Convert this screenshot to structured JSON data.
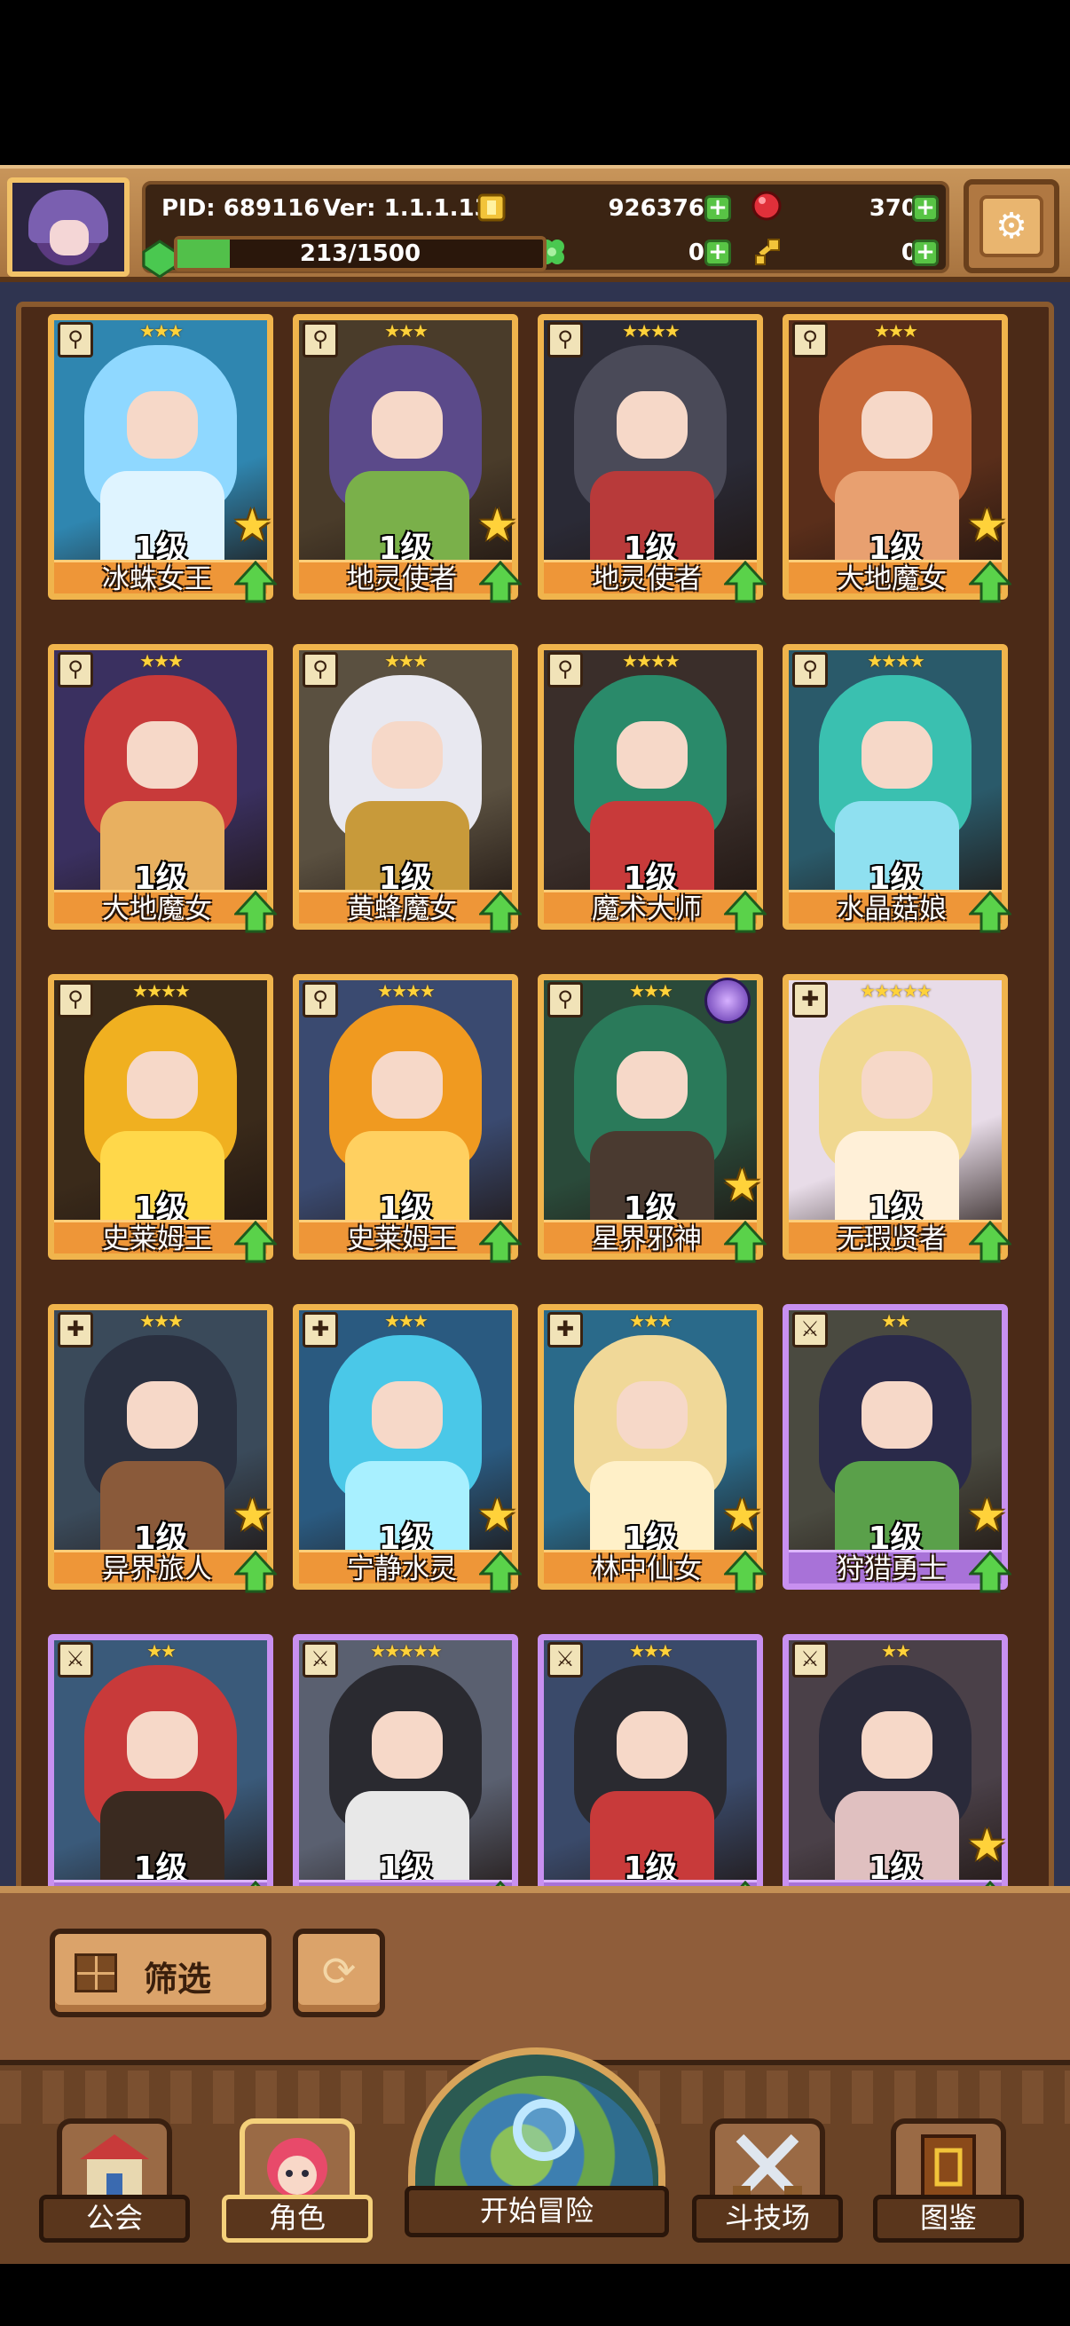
{
  "header": {
    "pid_label": "PID: 689116",
    "version_label": "Ver: 1.1.1.13",
    "gold": "926376",
    "gems": "370",
    "xp_text": "213/1500",
    "xp_progress": 0.142,
    "clover": "0",
    "key": "0"
  },
  "cards": [
    {
      "name": "冰蛛女王",
      "level": "1级",
      "stars": "★★★",
      "frame": "gold",
      "class_icon": "wand-icon",
      "star_badge": true,
      "palette": [
        "#2f86b0",
        "#8fd8ff",
        "#dff4ff"
      ]
    },
    {
      "name": "地灵使者",
      "level": "1级",
      "stars": "★★★",
      "frame": "gold",
      "class_icon": "wand-icon",
      "star_badge": true,
      "palette": [
        "#4a3c2a",
        "#5b4a8a",
        "#7ab04a"
      ]
    },
    {
      "name": "地灵使者",
      "level": "1级",
      "stars": "★★★★",
      "frame": "gold",
      "class_icon": "wand-icon",
      "star_badge": false,
      "palette": [
        "#2a2a36",
        "#4a4a58",
        "#b83a3a"
      ]
    },
    {
      "name": "大地魔女",
      "level": "1级",
      "stars": "★★★",
      "frame": "gold",
      "class_icon": "wand-icon",
      "star_badge": true,
      "palette": [
        "#5a2e1a",
        "#c86a3a",
        "#e8a070"
      ]
    },
    {
      "name": "大地魔女",
      "level": "1级",
      "stars": "★★★",
      "frame": "gold",
      "class_icon": "wand-icon",
      "star_badge": false,
      "palette": [
        "#3a3060",
        "#c83a3a",
        "#e8b060"
      ]
    },
    {
      "name": "黄蜂魔女",
      "level": "1级",
      "stars": "★★★",
      "frame": "gold",
      "class_icon": "wand-icon",
      "star_badge": false,
      "palette": [
        "#5a5040",
        "#e8e8f0",
        "#c89a3a"
      ]
    },
    {
      "name": "魔术大师",
      "level": "1级",
      "stars": "★★★★",
      "frame": "gold",
      "class_icon": "wand-icon",
      "star_badge": false,
      "palette": [
        "#3a2e2a",
        "#2a8a6a",
        "#c83a3a"
      ]
    },
    {
      "name": "水晶菇娘",
      "level": "1级",
      "stars": "★★★★",
      "frame": "gold",
      "class_icon": "wand-icon",
      "star_badge": false,
      "palette": [
        "#2a5a6a",
        "#3ac0b0",
        "#8fe0f0"
      ]
    },
    {
      "name": "史莱姆王",
      "level": "1级",
      "stars": "★★★★",
      "frame": "gold",
      "class_icon": "wand-icon",
      "star_badge": false,
      "palette": [
        "#3a2a1a",
        "#f0b020",
        "#ffd84a"
      ]
    },
    {
      "name": "史莱姆王",
      "level": "1级",
      "stars": "★★★★",
      "frame": "gold",
      "class_icon": "wand-icon",
      "star_badge": false,
      "palette": [
        "#3a4a70",
        "#f09a20",
        "#ffd060"
      ]
    },
    {
      "name": "星界邪神",
      "level": "1级",
      "stars": "★★★",
      "frame": "gold",
      "class_icon": "wand-icon",
      "star_badge": true,
      "rune_badge": true,
      "palette": [
        "#2a4a3a",
        "#2a7a5a",
        "#4a3a30"
      ]
    },
    {
      "name": "无瑕贤者",
      "level": "1级",
      "stars": "★★★★★",
      "frame": "gold",
      "class_icon": "cross-icon",
      "star_badge": false,
      "palette": [
        "#e8dce8",
        "#f0d890",
        "#fff0d8"
      ]
    },
    {
      "name": "异界旅人",
      "level": "1级",
      "stars": "★★★",
      "frame": "gold",
      "class_icon": "cross-icon",
      "star_badge": true,
      "palette": [
        "#3a4a5a",
        "#2a3040",
        "#8a5a3a"
      ]
    },
    {
      "name": "宁静水灵",
      "level": "1级",
      "stars": "★★★",
      "frame": "gold",
      "class_icon": "cross-icon",
      "star_badge": true,
      "palette": [
        "#2a5a80",
        "#4ac8e8",
        "#a8f0ff"
      ]
    },
    {
      "name": "林中仙女",
      "level": "1级",
      "stars": "★★★",
      "frame": "gold",
      "class_icon": "cross-icon",
      "star_badge": true,
      "palette": [
        "#2a6a8a",
        "#f0d898",
        "#fff0c8"
      ]
    },
    {
      "name": "狩猎勇士",
      "level": "1级",
      "stars": "★★",
      "frame": "purple",
      "class_icon": "sword-icon",
      "star_badge": true,
      "palette": [
        "#4a4a40",
        "#2a2a4a",
        "#5aa04a"
      ]
    },
    {
      "name": "",
      "level": "1级",
      "stars": "★★",
      "frame": "purple",
      "class_icon": "sword-icon",
      "star_badge": false,
      "palette": [
        "#3a5a7a",
        "#c83a3a",
        "#3a2a20"
      ]
    },
    {
      "name": "",
      "level": "1级",
      "stars": "★★★★★",
      "frame": "purple",
      "class_icon": "sword-icon",
      "star_badge": false,
      "palette": [
        "#5a6070",
        "#2a2a30",
        "#e8e8e8"
      ]
    },
    {
      "name": "",
      "level": "1级",
      "stars": "★★★",
      "frame": "purple",
      "class_icon": "sword-icon",
      "star_badge": false,
      "palette": [
        "#3a4a6a",
        "#2a2a30",
        "#c83a3a"
      ]
    },
    {
      "name": "",
      "level": "1级",
      "stars": "★★",
      "frame": "purple",
      "class_icon": "sword-icon",
      "star_badge": true,
      "palette": [
        "#4a4048",
        "#2a2a3a",
        "#e0c0c0"
      ]
    }
  ],
  "filter": {
    "label": "筛选"
  },
  "nav": {
    "guild": "公会",
    "characters": "角色",
    "adventure": "开始冒险",
    "arena": "斗技场",
    "codex": "图鉴"
  },
  "colors": {
    "gold_frame": "#f0b44c",
    "purple_frame": "#c890f0",
    "panel_bg": "#4b2a17",
    "accent_green": "#58c445"
  }
}
